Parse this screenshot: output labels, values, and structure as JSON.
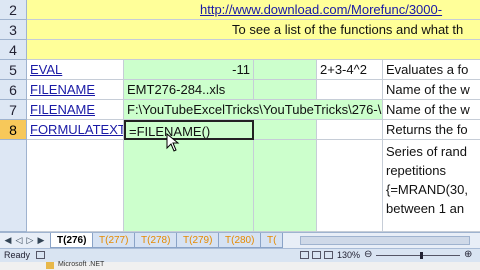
{
  "rows": {
    "r2": {
      "num": "2",
      "link": "http://www.download.com/Morefunc/3000-"
    },
    "r3": {
      "num": "3",
      "text": "To see a list of the functions and what th"
    },
    "r4": {
      "num": "4"
    },
    "r5": {
      "num": "5",
      "a": "EVAL",
      "b": "-11",
      "d": "2+3-4^2",
      "e": "Evaluates a fo"
    },
    "r6": {
      "num": "6",
      "a": "FILENAME",
      "b": "EMT276-284..xls",
      "e": "Name of the w"
    },
    "r7": {
      "num": "7",
      "a": "FILENAME",
      "b": "F:\\YouTubeExcelTricks\\YouTubeTricks\\276-\\",
      "e": "Name of the w"
    },
    "r8": {
      "num": "8",
      "a": "FORMULATEXT",
      "b": "=FILENAME()",
      "e": "Returns the fo"
    },
    "extra": [
      "Series of rand",
      "repetitions",
      "{=MRAND(30,",
      "between 1 an"
    ]
  },
  "tabs": [
    "T(276)",
    "T(277)",
    "T(278)",
    "T(279)",
    "T(280)",
    "T("
  ],
  "status": {
    "left": "Ready",
    "zoom": "130%"
  },
  "taskbar": {
    "item": "Microsoft .NET"
  },
  "colors": {
    "yellow": "#ffff99",
    "green": "#ccffcc",
    "tab_orange": "#e58a00"
  }
}
